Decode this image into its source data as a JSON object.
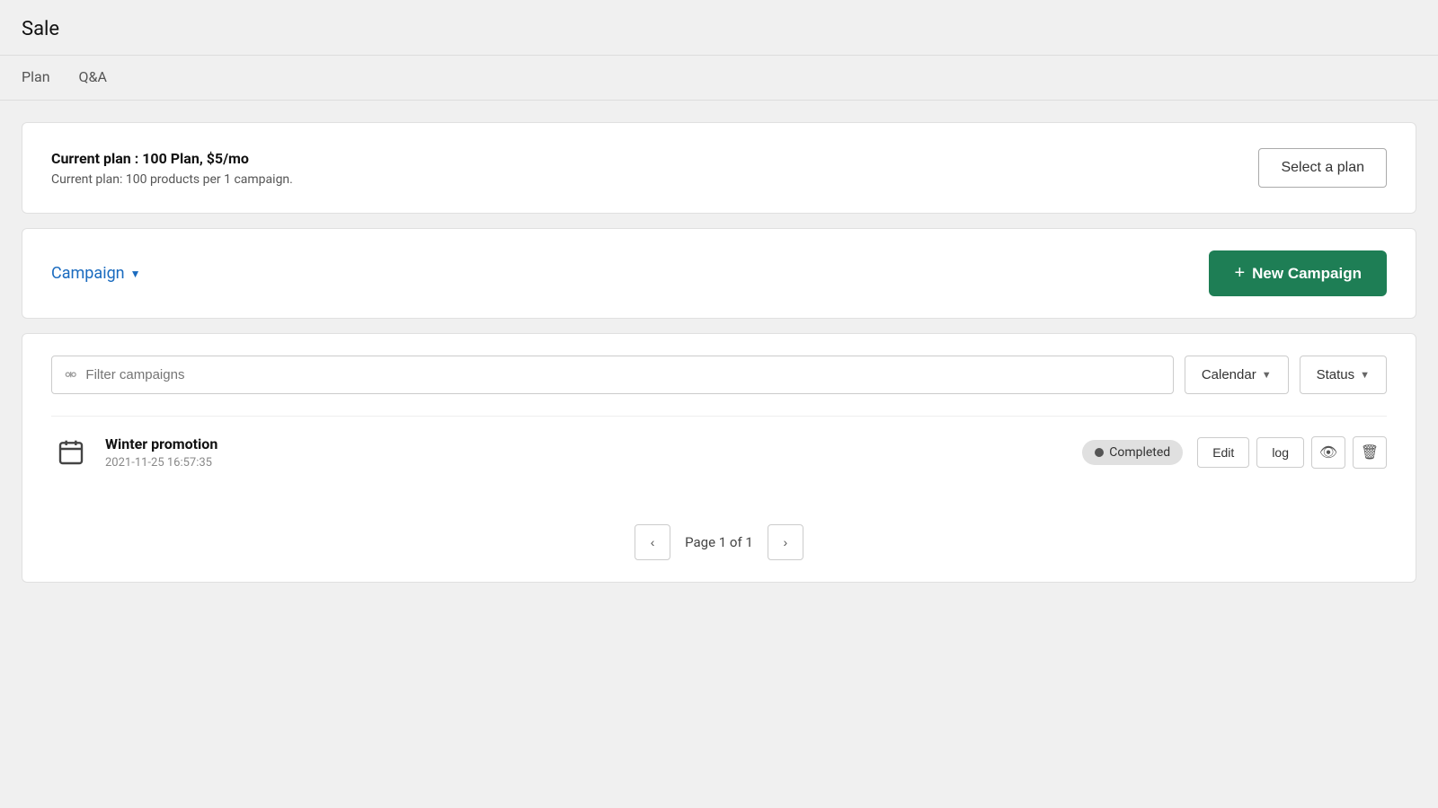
{
  "page": {
    "title": "Sale"
  },
  "tabs": [
    {
      "id": "plan",
      "label": "Plan"
    },
    {
      "id": "qna",
      "label": "Q&A"
    }
  ],
  "plan_card": {
    "current_plan_title": "Current plan : 100 Plan, $5/mo",
    "current_plan_desc": "Current plan: 100 products per 1 campaign.",
    "select_plan_label": "Select a plan"
  },
  "campaign_header": {
    "label": "Campaign",
    "new_campaign_label": "New Campaign",
    "plus_symbol": "+"
  },
  "campaign_list": {
    "search_placeholder": "Filter campaigns",
    "calendar_label": "Calendar",
    "status_label": "Status",
    "campaigns": [
      {
        "id": 1,
        "name": "Winter promotion",
        "date": "2021-11-25 16:57:35",
        "status": "Completed"
      }
    ],
    "pagination": {
      "page_info": "Page 1 of 1"
    }
  },
  "actions": {
    "edit_label": "Edit",
    "log_label": "log"
  }
}
